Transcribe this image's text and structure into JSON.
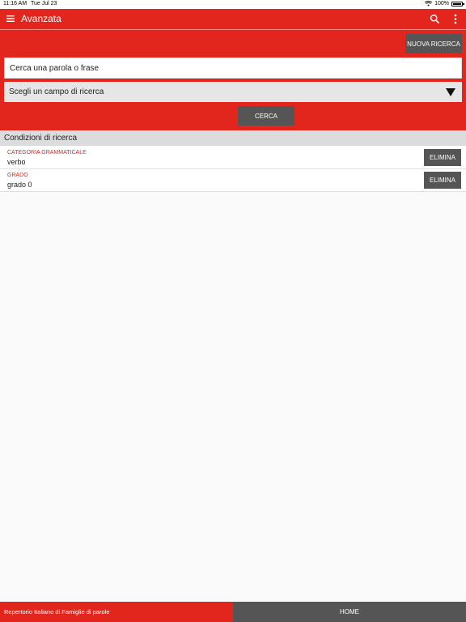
{
  "status_bar": {
    "time": "11:16 AM",
    "date": "Tue Jul 23",
    "battery": "100%"
  },
  "app_bar": {
    "title": "Avanzata",
    "icons": [
      "menu-icon",
      "search-icon",
      "more-vertical-icon"
    ]
  },
  "search_panel": {
    "new_search_label": "NUOVA RICERCA",
    "search_placeholder": "Cerca una parola o frase",
    "field_select_value": "Scegli un campo di ricerca",
    "search_button_label": "CERCA"
  },
  "conditions": {
    "header": "Condizioni di ricerca",
    "items": [
      {
        "label": "CATEGORIA GRAMMATICALE",
        "value": "verbo",
        "delete_label": "ELIMINA"
      },
      {
        "label": "GRADO",
        "value": "grado 0",
        "delete_label": "ELIMINA"
      }
    ]
  },
  "footer": {
    "brand": "Repertorio Italiano di Famiglie di parole",
    "home_label": "HOME"
  },
  "colors": {
    "accent": "#e3261d",
    "button_dark": "#555555"
  }
}
